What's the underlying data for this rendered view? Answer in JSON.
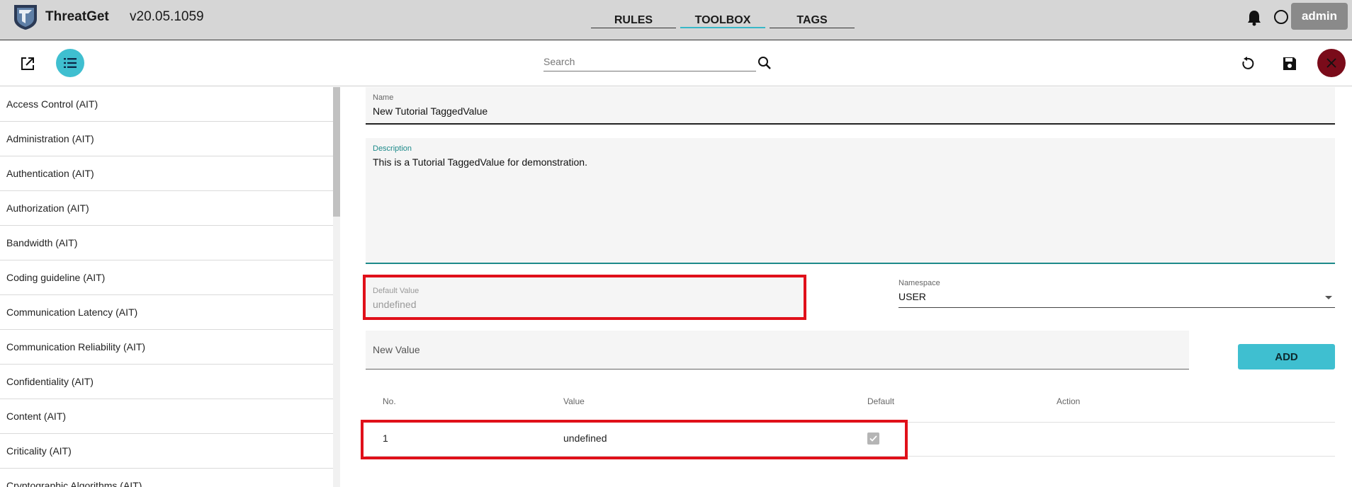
{
  "app": {
    "name": "ThreatGet",
    "version": "v20.05.1059"
  },
  "tabs": [
    {
      "label": "RULES",
      "active": false
    },
    {
      "label": "TOOLBOX",
      "active": true
    },
    {
      "label": "TAGS",
      "active": false
    }
  ],
  "user": {
    "name": "admin"
  },
  "toolbar": {
    "search_placeholder": "Search"
  },
  "sidebar": {
    "items": [
      "Access Control (AIT)",
      "Administration (AIT)",
      "Authentication (AIT)",
      "Authorization (AIT)",
      "Bandwidth (AIT)",
      "Coding guideline (AIT)",
      "Communication Latency (AIT)",
      "Communication Reliability (AIT)",
      "Confidentiality (AIT)",
      "Content (AIT)",
      "Criticality (AIT)",
      "Cryptographic Algorithms (AIT)"
    ]
  },
  "form": {
    "name": {
      "label": "Name",
      "value": "New Tutorial TaggedValue"
    },
    "description": {
      "label": "Description",
      "value": "This is  a Tutorial TaggedValue for demonstration."
    },
    "default_value": {
      "label": "Default Value",
      "value": "undefined"
    },
    "namespace": {
      "label": "Namespace",
      "value": "USER"
    },
    "new_value": {
      "placeholder": "New Value"
    },
    "add_label": "ADD"
  },
  "table": {
    "headers": {
      "no": "No.",
      "value": "Value",
      "default": "Default",
      "action": "Action"
    },
    "rows": [
      {
        "no": "1",
        "value": "undefined",
        "default": true
      }
    ]
  },
  "colors": {
    "accent": "#3fbfd0",
    "close": "#7a0b1a",
    "highlight": "#e0101a",
    "topbar": "#d6d6d6"
  }
}
